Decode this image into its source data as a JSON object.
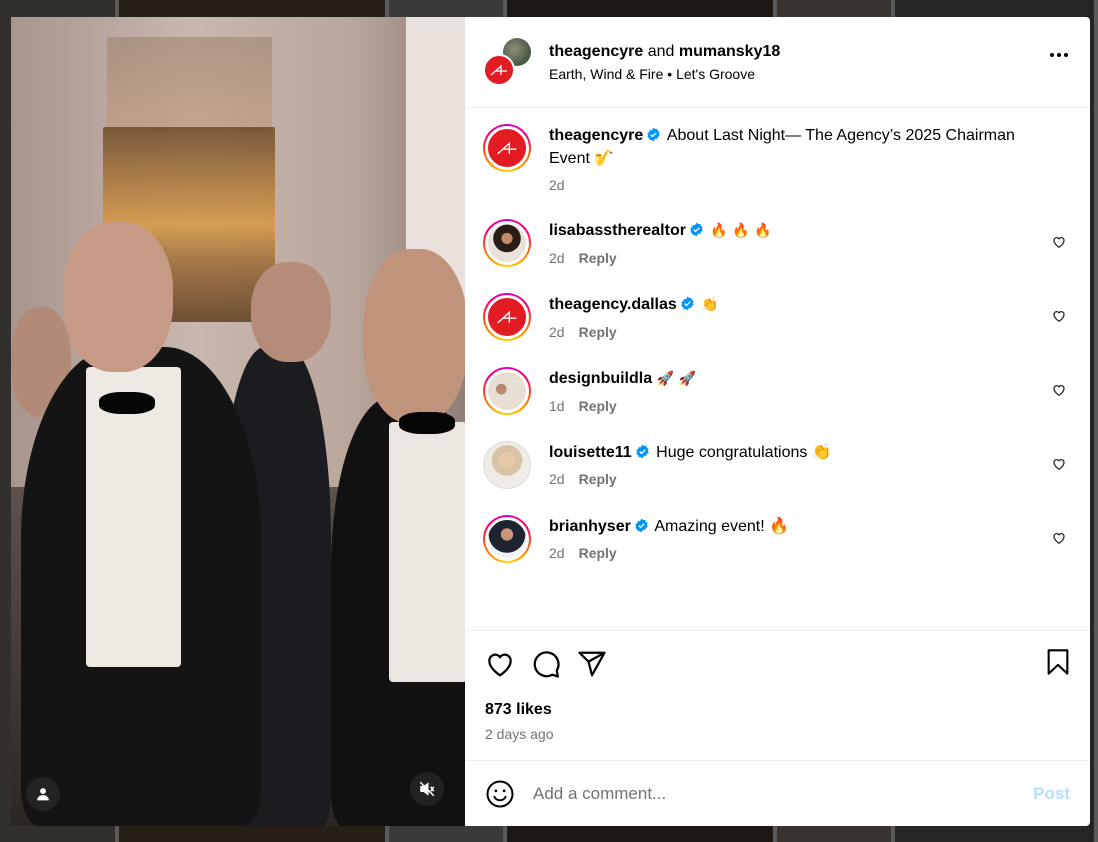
{
  "header": {
    "user1": "theagencyre",
    "and": "and",
    "user2": "mumansky18",
    "artist": "Earth, Wind & Fire",
    "separator": "•",
    "song": "Let's Groove"
  },
  "caption": {
    "username": "theagencyre",
    "text": "About Last Night— The Agency’s 2025 Chairman Event 🎷",
    "time": "2d"
  },
  "comments": [
    {
      "username": "lisabasstherealtor",
      "verified": true,
      "text": "🔥 🔥 🔥",
      "time": "2d",
      "reply": "Reply",
      "avatar": "lisa"
    },
    {
      "username": "theagency.dallas",
      "verified": true,
      "text": "👏",
      "time": "2d",
      "reply": "Reply",
      "avatar": "agency"
    },
    {
      "username": "designbuildla",
      "verified": false,
      "text": "🚀 🚀",
      "time": "1d",
      "reply": "Reply",
      "avatar": "design"
    },
    {
      "username": "louisette11",
      "verified": true,
      "text": "Huge congratulations 👏",
      "time": "2d",
      "reply": "Reply",
      "avatar": "louise"
    },
    {
      "username": "brianhyser",
      "verified": true,
      "text": "Amazing event! 🔥",
      "time": "2d",
      "reply": "Reply",
      "avatar": "brian"
    }
  ],
  "actions": {
    "likes": "873 likes",
    "ago": "2 days ago"
  },
  "composer": {
    "placeholder": "Add a comment...",
    "post_label": "Post"
  },
  "icons": {
    "like": "heart-icon",
    "comment": "comment-icon",
    "share": "share-icon",
    "save": "bookmark-icon",
    "emoji": "emoji-icon",
    "mute": "muted-speaker-icon",
    "tags": "user-tag-icon",
    "more": "more-options-icon"
  },
  "colors": {
    "brand_red": "#e31b23",
    "verified_blue": "#0095f6",
    "post_disabled": "#b2dffc",
    "secondary_text": "#737373"
  }
}
